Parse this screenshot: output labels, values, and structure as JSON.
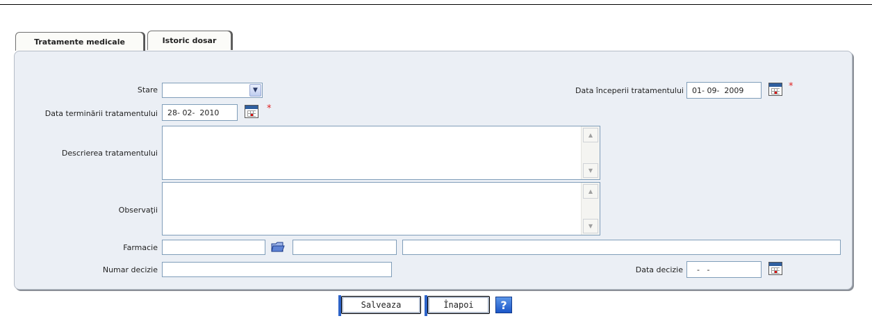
{
  "tabs": [
    {
      "label": "Tratamente medicale"
    },
    {
      "label": "Istoric dosar"
    }
  ],
  "form": {
    "stare": {
      "label": "Stare",
      "value": ""
    },
    "data_inceperii": {
      "label": "Data începerii tratamentului",
      "value": "01- 09-  2009"
    },
    "data_terminarii": {
      "label": "Data terminării tratamentului",
      "value": "28- 02-  2010"
    },
    "descriere": {
      "label": "Descrierea tratamentului",
      "value": ""
    },
    "observatii": {
      "label": "Observaţii",
      "value": ""
    },
    "farmacie": {
      "label": "Farmacie",
      "code": "",
      "name": "",
      "address": ""
    },
    "numar_decizie": {
      "label": "Numar decizie",
      "value": ""
    },
    "data_decizie": {
      "label": "Data decizie",
      "value": "  -   -"
    },
    "required_mark": "*"
  },
  "buttons": {
    "save": "Salveaza",
    "back": "Înapoi",
    "help": "?"
  },
  "icons": {
    "calendar": "calendar-icon",
    "folder": "folder-icon",
    "dropdown": "chevron-down-icon",
    "scroll_up": "scroll-up-icon",
    "scroll_down": "scroll-down-icon"
  },
  "colors": {
    "panel_bg": "#ebeff5",
    "required": "#e02020",
    "accent": "#2d63c8"
  }
}
